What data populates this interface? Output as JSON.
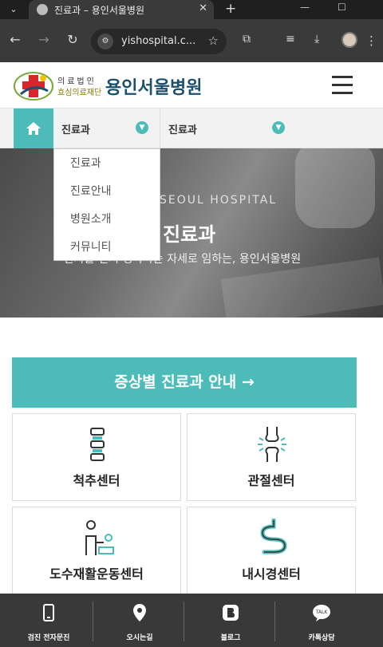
{
  "browser": {
    "tab_title": "진료과 – 용인서울병원",
    "url": "yishospital.c...",
    "icons": [
      "chevron-down-icon",
      "globe-icon",
      "close-icon",
      "plus-icon",
      "minimize-icon",
      "maximize-icon",
      "back-icon",
      "forward-icon",
      "reload-icon",
      "site-info-icon",
      "star-icon",
      "extensions-icon",
      "media-icon",
      "download-icon",
      "profile-icon",
      "menu-dots-icon"
    ]
  },
  "header": {
    "logo_sub": "의료법인",
    "logo_sub2": "효심의료재단",
    "hospital_name": "용인서울병원"
  },
  "subnav": {
    "select1": "진료과",
    "select2": "진료과"
  },
  "dropdown": {
    "items": [
      "진료과",
      "진료안내",
      "병원소개",
      "커뮤니티"
    ]
  },
  "hero": {
    "english": "SEOUL HOSPITAL",
    "title": "진료과",
    "subtitle": "환자를 먼저 생각하는 자세로 임하는, 용인서울병원"
  },
  "main": {
    "banner": "증상별 진료과 안내 →",
    "cards": [
      "척추센터",
      "관절센터",
      "도수재활운동센터",
      "내시경센터"
    ]
  },
  "bottom_bar": {
    "items": [
      "검진 전자문진",
      "오시는길",
      "블로그",
      "카톡상담"
    ],
    "talk_badge": "TALK"
  },
  "colors": {
    "accent": "#4dbbb8",
    "brand_text": "#1b4f6b",
    "browser_bg": "#3a3a3a"
  }
}
